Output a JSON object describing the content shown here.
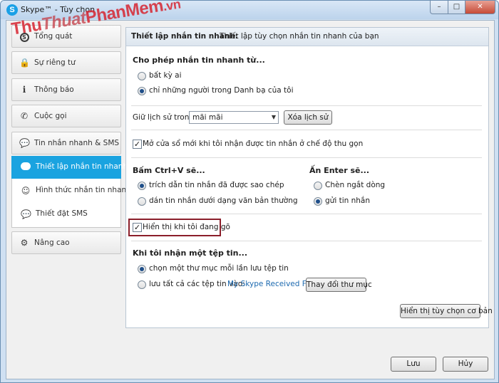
{
  "window": {
    "title": "Skype™ - Tùy chọn",
    "app_icon_letter": "S",
    "min_label": "–",
    "max_label": "□",
    "close_label": "✕"
  },
  "watermark": {
    "part1": "Thu",
    "part2": "Thuat",
    "part3": "PhanMem",
    "part4": ".vn"
  },
  "sidebar": {
    "items": [
      {
        "label": "Tổng quát",
        "icon": "skype-icon"
      },
      {
        "label": "Sự riêng tư",
        "icon": "lock-icon"
      },
      {
        "label": "Thông báo",
        "icon": "info-icon"
      },
      {
        "label": "Cuộc gọi",
        "icon": "phone-icon"
      },
      {
        "label": "Tin nhắn nhanh & SMS",
        "icon": "chat-icon"
      }
    ],
    "subitems": [
      {
        "label": "Thiết lập nhắn tin nhanh",
        "icon": "chat-bubble-icon",
        "active": true
      },
      {
        "label": "Hình thức nhắn tin nhanh",
        "icon": "smiley-icon",
        "active": false
      },
      {
        "label": "Thiết đặt SMS",
        "icon": "sms-icon",
        "active": false
      }
    ],
    "advanced": {
      "label": "Nâng cao",
      "icon": "gear-icon"
    }
  },
  "panel": {
    "header_title": "Thiết lập nhắn tin nhanh:",
    "header_desc": "Thiết lập tùy chọn nhắn tin nhanh của bạn",
    "allow_from": {
      "title": "Cho phép nhắn tin nhanh từ...",
      "options": [
        "bất kỳ ai",
        "chỉ những người trong Danh bạ của tôi"
      ],
      "selected": 1
    },
    "history": {
      "label": "Giữ lịch sử trong",
      "value": "mãi mãi",
      "clear_button": "Xóa lịch sử"
    },
    "open_window": {
      "label": "Mở cửa sổ mới khi tôi nhận được tin nhắn ở chế độ thu gọn",
      "checked": true
    },
    "ctrl_v": {
      "title": "Bấm Ctrl+V sẽ...",
      "options": [
        "trích dẫn tin nhắn đã được sao chép",
        "dán tin nhắn dưới dạng văn bản thường"
      ],
      "selected": 0
    },
    "enter": {
      "title": "Ấn Enter sẽ...",
      "options": [
        "Chèn ngắt dòng",
        "gửi tin nhắn"
      ],
      "selected": 1
    },
    "show_typing": {
      "label": "Hiển thị khi tôi đang gõ",
      "checked": true
    },
    "file_receive": {
      "title": "Khi tôi nhận một tệp tin...",
      "option1": "chọn một thư mục mỗi lần lưu tệp tin",
      "option2": "lưu tất cả các tệp tin vào:",
      "folder_link": "My Skype Received Files",
      "change_button": "Thay đổi thư mục",
      "selected": 0
    },
    "advanced_button": "Hiển thị tùy chọn cơ bản"
  },
  "footer": {
    "save": "Lưu",
    "cancel": "Hủy"
  },
  "colors": {
    "accent": "#1aa3e0",
    "highlight": "#8b1e2a",
    "link": "#1d6ab0"
  }
}
